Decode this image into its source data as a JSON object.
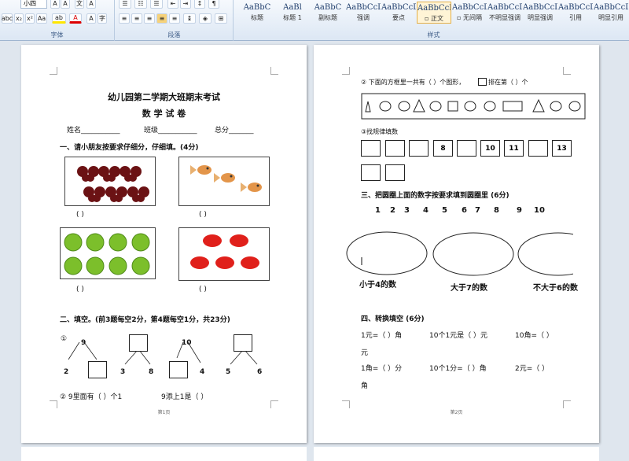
{
  "ribbon": {
    "font_size": "小四",
    "font_group": "字体",
    "paragraph_group": "段落",
    "styles_group": "样式",
    "styles": [
      {
        "preview": "AaBbC",
        "name": "标题"
      },
      {
        "preview": "AaBl",
        "name": "标题 1"
      },
      {
        "preview": "AaBbC",
        "name": "副标题"
      },
      {
        "preview": "AaBbCcDd",
        "name": "强调"
      },
      {
        "preview": "AaBbCcD",
        "name": "要点"
      },
      {
        "preview": "AaBbCcDd",
        "name": "▫ 正文"
      },
      {
        "preview": "AaBbCcDd",
        "name": "▫ 无间隔"
      },
      {
        "preview": "AaBbCcDd",
        "name": "不明显强调"
      },
      {
        "preview": "AaBbCcDd",
        "name": "明显强调"
      },
      {
        "preview": "AaBbCcDd",
        "name": "引用"
      },
      {
        "preview": "AaBbCcDd",
        "name": "明显引用"
      }
    ]
  },
  "page1": {
    "title": "幼儿园第二学期大班期末考试",
    "subtitle": "数 学 试 卷",
    "name_label": "姓名___________",
    "class_label": "班级___________",
    "score_label": "总分_______",
    "section1": "一、请小朋友按要求仔细分，仔细填。(4分)",
    "paren": "(            )",
    "section2": "二、填空。(前3题每空2分，第4题每空1分，共23分)",
    "q1_marker": "①",
    "tree1": {
      "top": "9",
      "left": "2"
    },
    "tree2": {
      "left": "3",
      "right": "8"
    },
    "tree3": {
      "top": "10",
      "right": "4"
    },
    "tree4": {
      "left": "5",
      "right": "6"
    },
    "q2a": "② 9里面有（    ）个1",
    "q2b": "9添上1是（    ）",
    "footer": "第1页"
  },
  "page2": {
    "q2_line_a": "② 下面的方框里一共有（      ）个图形，",
    "q2_line_b": "排在第（      ）个",
    "q3_label": "③找规律填数",
    "pattern_numbers": [
      "",
      "",
      "",
      "8",
      "",
      "10",
      "11",
      "",
      "13"
    ],
    "section3": "三、把圆圈上面的数字按要求填到圆圈里   (6分)",
    "numbers": [
      "1",
      "2",
      "3",
      "4",
      "5",
      "6",
      "7",
      "8",
      "9",
      "10"
    ],
    "circle_labels": [
      "小于4的数",
      "大于7的数",
      "不大于6的数"
    ],
    "section4": "四、转换填空   (6分)",
    "row1": [
      "1元=（   ）角",
      "10个1元是（   ）元",
      "10角=（      ）"
    ],
    "row1_cont": "元",
    "row2": [
      "1角=（   ）分",
      "10个1分=（      ）角",
      "2元=（      ）"
    ],
    "row2_cont": "角",
    "footer": "第2页"
  },
  "colors": {
    "ribbon_label": "#3b5a85",
    "page_bg": "#ffffff",
    "workspace": "#dfe6ee"
  }
}
